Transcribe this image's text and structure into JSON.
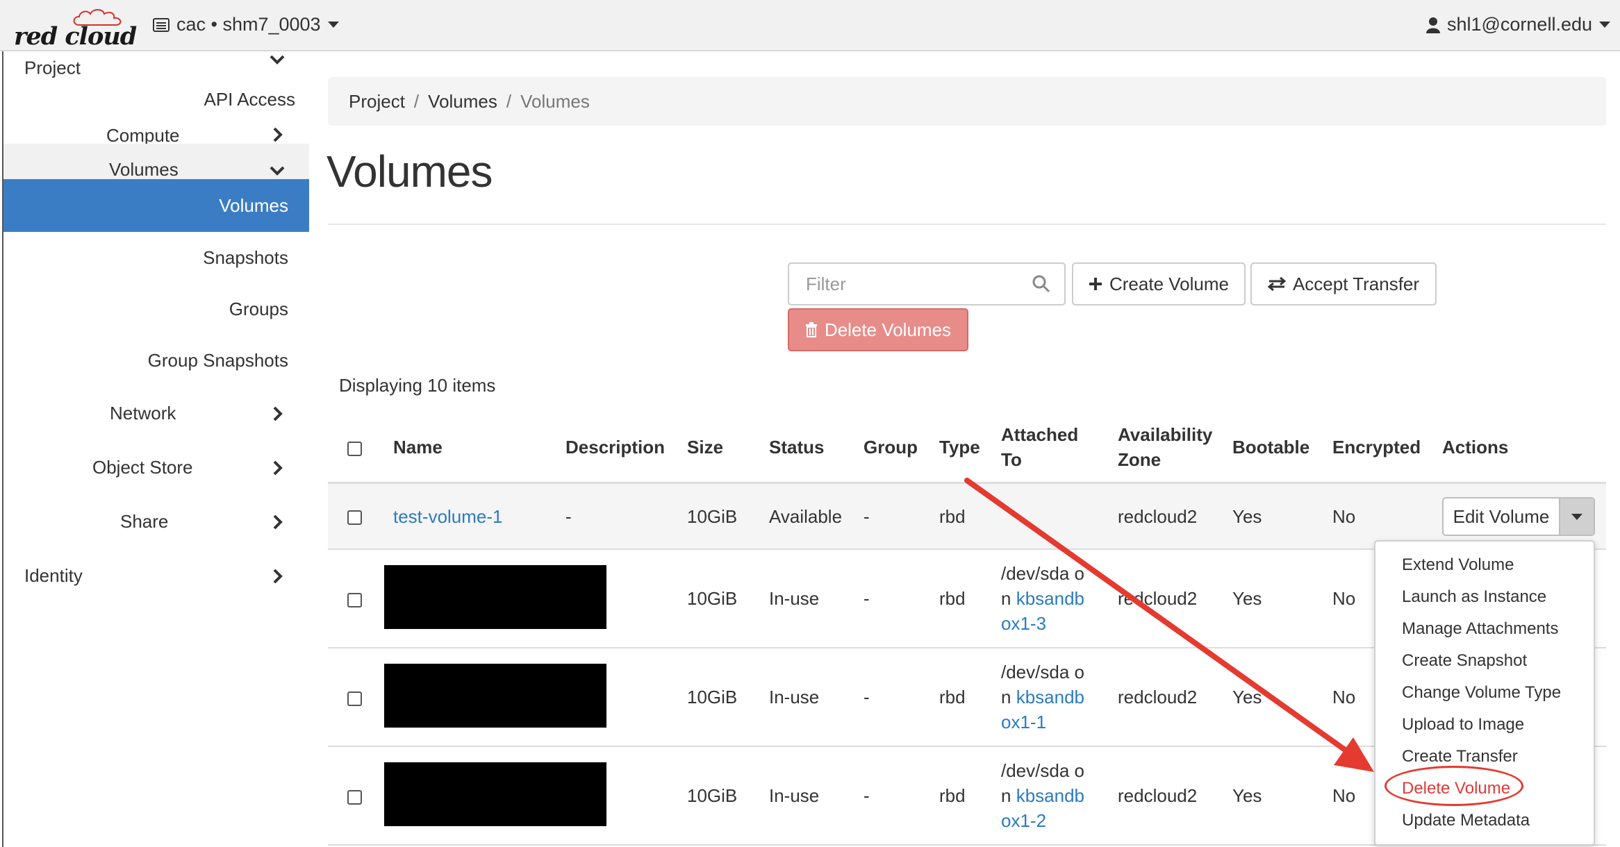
{
  "topbar": {
    "logo_text": "red cloud",
    "project_switch": "cac • shm7_0003",
    "user": "shl1@cornell.edu"
  },
  "sidebar": {
    "items": [
      {
        "label": "Project"
      },
      {
        "label": "API Access"
      },
      {
        "label": "Compute"
      },
      {
        "label": "Volumes"
      },
      {
        "label": "Volumes"
      },
      {
        "label": "Snapshots"
      },
      {
        "label": "Groups"
      },
      {
        "label": "Group Snapshots"
      },
      {
        "label": "Network"
      },
      {
        "label": "Object Store"
      },
      {
        "label": "Share"
      },
      {
        "label": "Identity"
      }
    ]
  },
  "breadcrumb": {
    "items": [
      "Project",
      "Volumes",
      "Volumes"
    ],
    "separator": "/"
  },
  "page_title": "Volumes",
  "toolbar": {
    "filter_placeholder": "Filter",
    "create_label": "Create Volume",
    "accept_transfer_label": "Accept Transfer",
    "delete_label": "Delete Volumes"
  },
  "count_text": "Displaying 10 items",
  "table": {
    "headers": {
      "name": "Name",
      "description": "Description",
      "size": "Size",
      "status": "Status",
      "group": "Group",
      "type": "Type",
      "attached_l1": "Attached",
      "attached_l2": "To",
      "az_l1": "Availability",
      "az_l2": "Zone",
      "bootable": "Bootable",
      "encrypted": "Encrypted",
      "actions": "Actions"
    },
    "rows": [
      {
        "name": "test-volume-1",
        "description": "-",
        "size": "10GiB",
        "status": "Available",
        "group": "-",
        "type": "rbd",
        "att_l1": "",
        "att_l2": "",
        "att_link_a": "",
        "att_link_b": "",
        "az": "redcloud2",
        "bootable": "Yes",
        "encrypted": "No"
      },
      {
        "name": "",
        "description": "",
        "size": "10GiB",
        "status": "In-use",
        "group": "-",
        "type": "rbd",
        "att_l1": "/dev/sda o",
        "att_l2": "n ",
        "att_link_a": "kbsandb",
        "att_link_b": "ox1-3",
        "az": "redcloud2",
        "bootable": "Yes",
        "encrypted": "No"
      },
      {
        "name": "",
        "description": "",
        "size": "10GiB",
        "status": "In-use",
        "group": "-",
        "type": "rbd",
        "att_l1": "/dev/sda o",
        "att_l2": "n ",
        "att_link_a": "kbsandb",
        "att_link_b": "ox1-1",
        "az": "redcloud2",
        "bootable": "Yes",
        "encrypted": "No"
      },
      {
        "name": "",
        "description": "",
        "size": "10GiB",
        "status": "In-use",
        "group": "-",
        "type": "rbd",
        "att_l1": "/dev/sda o",
        "att_l2": "n ",
        "att_link_a": "kbsandb",
        "att_link_b": "ox1-2",
        "az": "redcloud2",
        "bootable": "Yes",
        "encrypted": "No"
      }
    ],
    "edit_label": "Edit Volume"
  },
  "menu": {
    "items": [
      "Extend Volume",
      "Launch as Instance",
      "Manage Attachments",
      "Create Snapshot",
      "Change Volume Type",
      "Upload to Image",
      "Create Transfer",
      "Delete Volume",
      "Update Metadata"
    ]
  },
  "colors": {
    "accent": "#3b7dc5",
    "link": "#2a7bc0",
    "danger_button": "#e88c89",
    "annotation": "#e53a2f"
  }
}
